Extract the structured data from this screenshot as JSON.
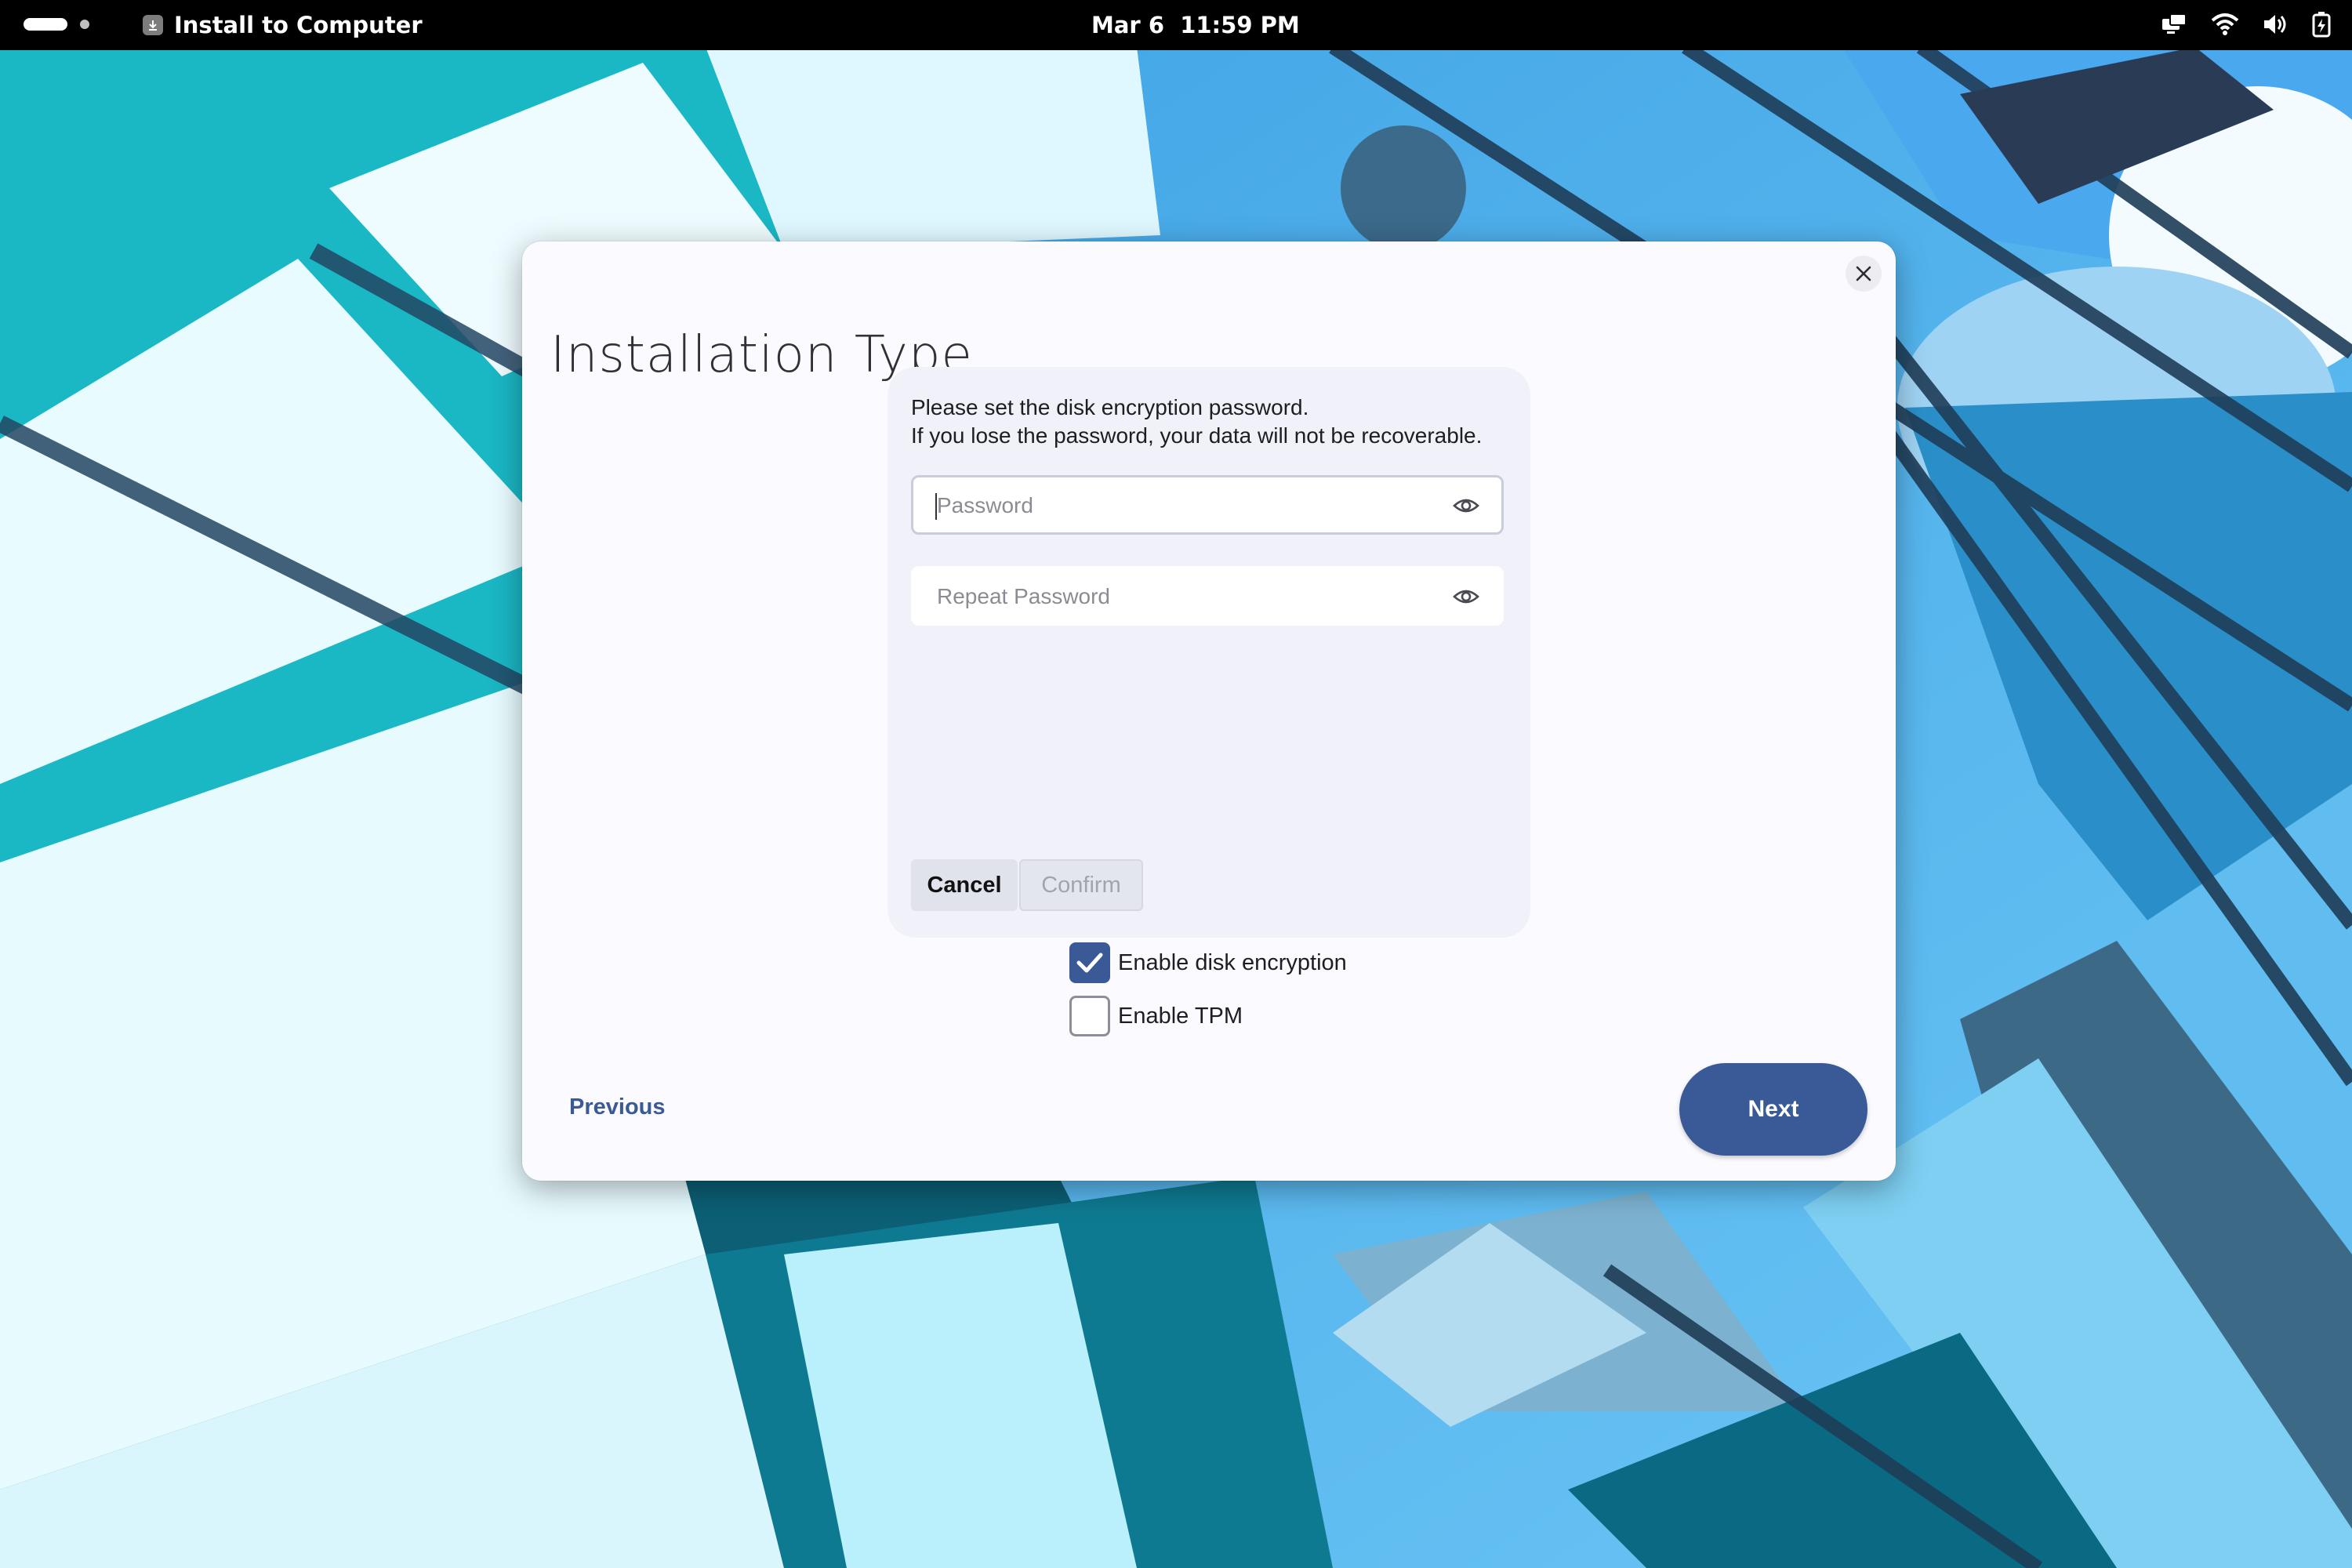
{
  "topbar": {
    "app_title": "Install to Computer",
    "clock": "Mar 6  11:59 PM"
  },
  "dialog": {
    "title": "Installation Type",
    "encryption_prompt": {
      "line1": "Please set the disk encryption password.",
      "line2": "If you lose the password, your data will not be recoverable.",
      "password_placeholder": "Password",
      "repeat_placeholder": "Repeat Password",
      "cancel_label": "Cancel",
      "confirm_label": "Confirm"
    },
    "options": [
      {
        "label": "Enable disk encryption",
        "checked": true
      },
      {
        "label": "Enable TPM",
        "checked": false
      }
    ],
    "previous_label": "Previous",
    "next_label": "Next"
  },
  "colors": {
    "accent": "#3a5a97",
    "dialog_bg": "#fbfaff",
    "subdialog_bg": "#f0f1f9"
  }
}
